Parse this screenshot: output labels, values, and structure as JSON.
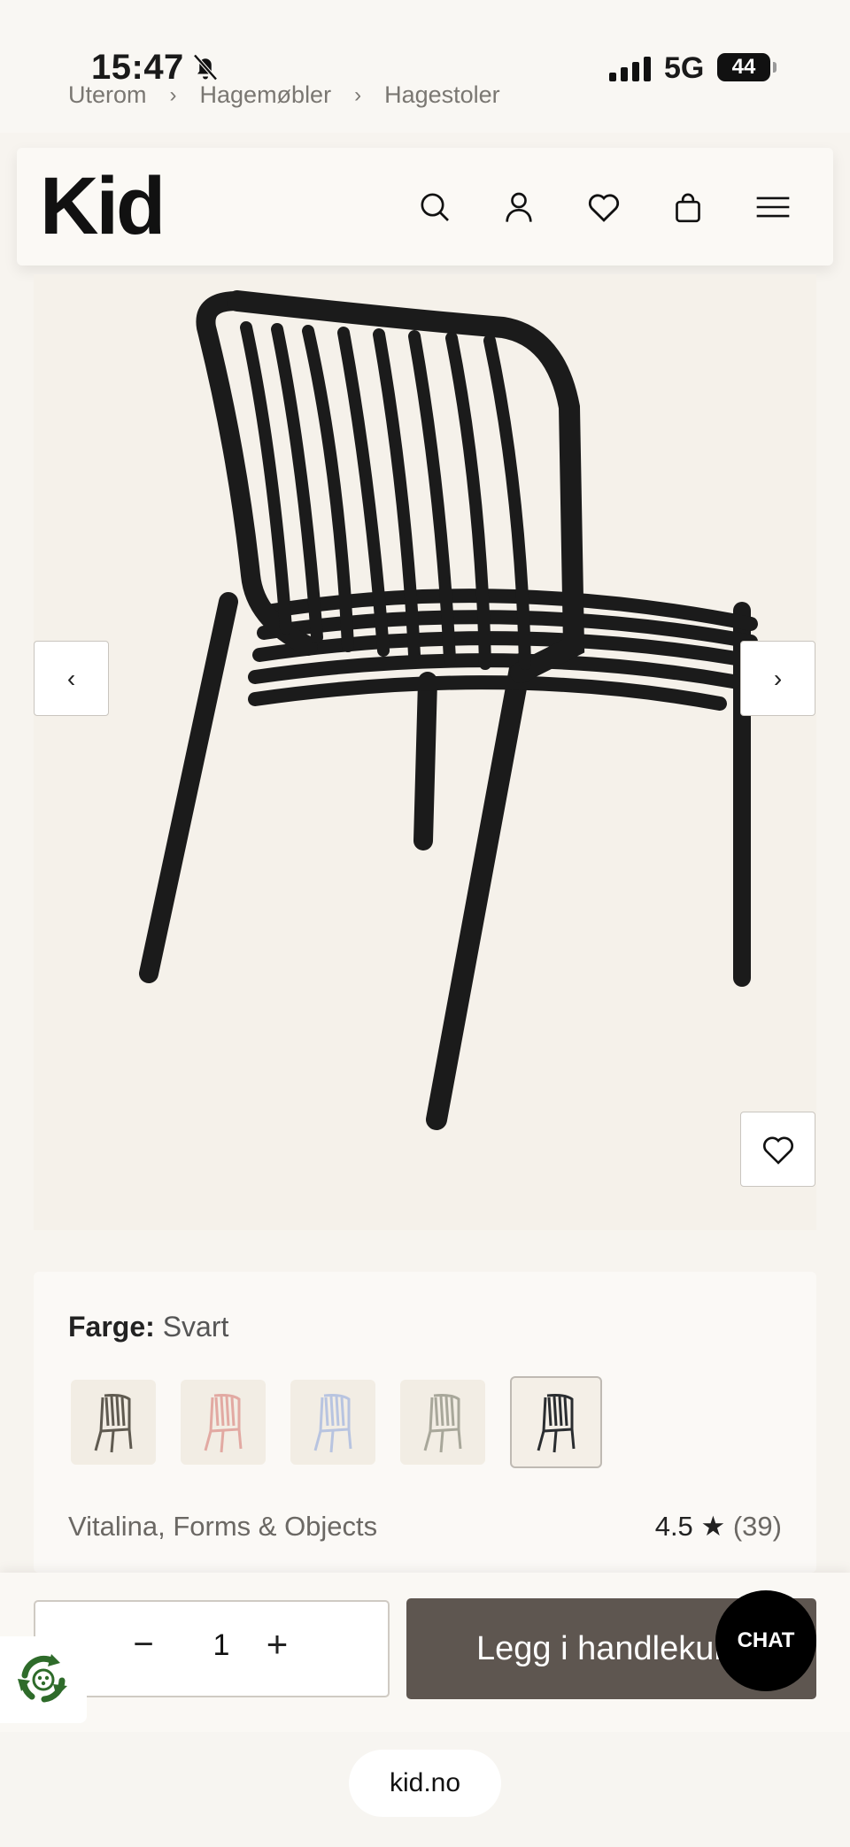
{
  "status_bar": {
    "time": "15:47",
    "network": "5G",
    "battery": "44"
  },
  "breadcrumb": {
    "items": [
      "Uterom",
      "Hagemøbler",
      "Hagestoler"
    ],
    "separator": "›"
  },
  "header": {
    "logo": "Kid",
    "icons": [
      "search-icon",
      "account-icon",
      "wishlist-icon",
      "cart-icon",
      "menu-icon"
    ]
  },
  "gallery": {
    "prev_label": "‹",
    "next_label": "›"
  },
  "product": {
    "color_label": "Farge:",
    "color_value": "Svart",
    "swatches": [
      {
        "color": "#5f5a50"
      },
      {
        "color": "#e2a9a2"
      },
      {
        "color": "#b8c4e0"
      },
      {
        "color": "#a8a79a"
      },
      {
        "color": "#2a2d30"
      }
    ],
    "vendor": "Vitalina, Forms & Objects",
    "rating_value": "4.5",
    "rating_star": "★",
    "rating_count": "(39)"
  },
  "cart": {
    "minus": "−",
    "quantity": "1",
    "plus": "+",
    "add_label": "Legg i handlekurv"
  },
  "chat": {
    "label": "CHAT"
  },
  "browser": {
    "url": "kid.no"
  },
  "colors": {
    "accent": "#5e5650",
    "background": "#f7f4ef"
  }
}
